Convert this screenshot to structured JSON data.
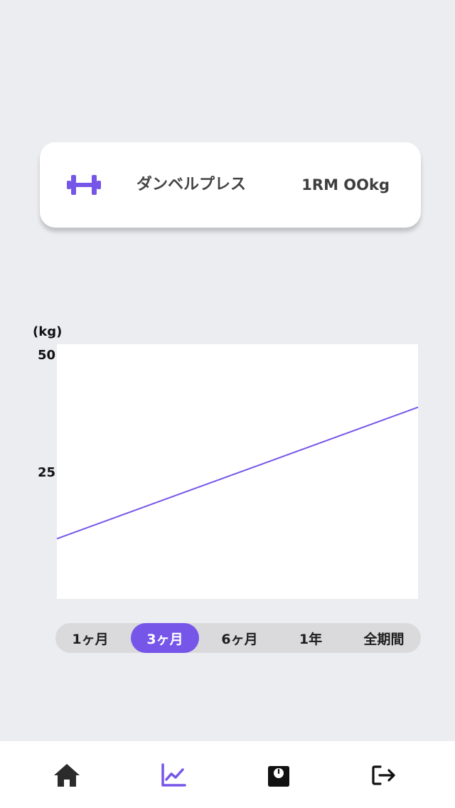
{
  "exercise": {
    "icon": "dumbbell-icon",
    "name": "ダンベルプレス",
    "one_rm": "1RM OOkg"
  },
  "chart_data": {
    "type": "line",
    "ylabel": "(kg)",
    "ylim": [
      0,
      50
    ],
    "yticks": [
      50,
      25
    ],
    "y_tick_labels": [
      "50",
      "25"
    ],
    "series": [
      {
        "x": [
          0,
          1
        ],
        "values": [
          11,
          39
        ]
      }
    ],
    "grid": false
  },
  "periods": {
    "selected": "3ヶ月",
    "options": [
      "1ヶ月",
      "3ヶ月",
      "6ヶ月",
      "1年",
      "全期間"
    ]
  },
  "tabbar": {
    "items": [
      {
        "icon": "home-icon",
        "active": false
      },
      {
        "icon": "chart-icon",
        "active": true
      },
      {
        "icon": "scale-icon",
        "active": false
      },
      {
        "icon": "logout-icon",
        "active": false
      }
    ]
  },
  "colors": {
    "accent": "#7656e8",
    "background": "#ecedf1",
    "icon_dark": "#2b2b2b"
  }
}
